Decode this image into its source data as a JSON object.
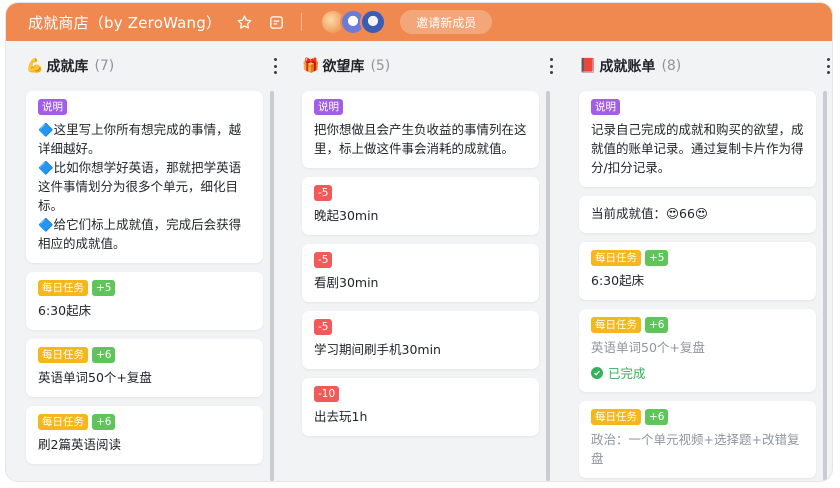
{
  "board": {
    "title": "成就商店（by ZeroWang）",
    "invite_label": "邀请新成员",
    "colors": {
      "header": "#f0894f",
      "background": "#f2f3f5"
    }
  },
  "columns": [
    {
      "emoji": "💪",
      "name": "成就库",
      "count": "(7)",
      "cards": [
        {
          "tags": [
            {
              "text": "说明",
              "color": "purple"
            }
          ],
          "text": "🔷这里写上你所有想完成的事情，越详细越好。\n🔷比如你想学好英语，那就把学英语这件事情划分为很多个单元，细化目标。\n🔷给它们标上成就值，完成后会获得相应的成就值。"
        },
        {
          "tags": [
            {
              "text": "每日任务",
              "color": "yellow"
            },
            {
              "text": "+5",
              "color": "green"
            }
          ],
          "text": "6:30起床"
        },
        {
          "tags": [
            {
              "text": "每日任务",
              "color": "yellow"
            },
            {
              "text": "+6",
              "color": "green"
            }
          ],
          "text": "英语单词50个+复盘"
        },
        {
          "tags": [
            {
              "text": "每日任务",
              "color": "yellow"
            },
            {
              "text": "+6",
              "color": "green"
            }
          ],
          "text": "刷2篇英语阅读"
        }
      ]
    },
    {
      "emoji": "🎁",
      "name": "欲望库",
      "count": "(5)",
      "cards": [
        {
          "tags": [
            {
              "text": "说明",
              "color": "purple"
            }
          ],
          "text": "把你想做且会产生负收益的事情列在这里，标上做这件事会消耗的成就值。"
        },
        {
          "tags": [
            {
              "text": "-5",
              "color": "red"
            }
          ],
          "text": "晚起30min"
        },
        {
          "tags": [
            {
              "text": "-5",
              "color": "red"
            }
          ],
          "text": "看剧30min"
        },
        {
          "tags": [
            {
              "text": "-5",
              "color": "red"
            }
          ],
          "text": "学习期间刷手机30min"
        },
        {
          "tags": [
            {
              "text": "-10",
              "color": "red"
            }
          ],
          "text": "出去玩1h"
        }
      ]
    },
    {
      "emoji": "📕",
      "name": "成就账单",
      "count": "(8)",
      "cards": [
        {
          "tags": [
            {
              "text": "说明",
              "color": "purple"
            }
          ],
          "text": "记录自己完成的成就和购买的欲望，成就值的账单记录。通过复制卡片作为得分/扣分记录。"
        },
        {
          "tags": [],
          "text": "当前成就值：😍66😍"
        },
        {
          "tags": [
            {
              "text": "每日任务",
              "color": "yellow"
            },
            {
              "text": "+5",
              "color": "green"
            }
          ],
          "text": "6:30起床"
        },
        {
          "tags": [
            {
              "text": "每日任务",
              "color": "yellow"
            },
            {
              "text": "+6",
              "color": "green"
            }
          ],
          "text": "英语单词50个+复盘",
          "muted": true,
          "done_label": "已完成"
        },
        {
          "tags": [
            {
              "text": "每日任务",
              "color": "yellow"
            },
            {
              "text": "+6",
              "color": "green"
            }
          ],
          "text": "政治：一个单元视频+选择题+改错复盘",
          "muted": true
        }
      ]
    }
  ]
}
